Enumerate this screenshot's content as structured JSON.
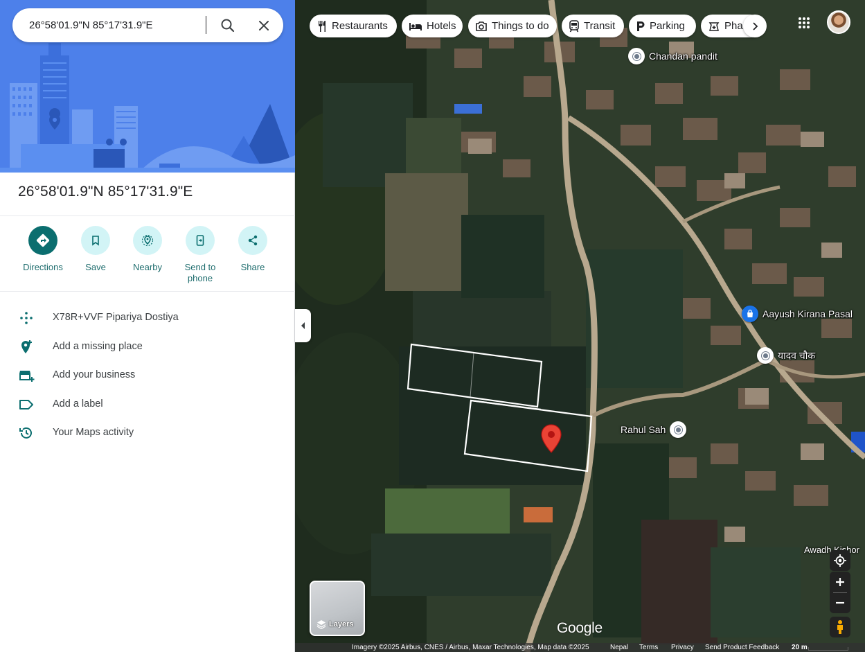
{
  "search": {
    "value": "26°58'01.9\"N 85°17'31.9\"E",
    "placeholder": ""
  },
  "place": {
    "title": "26°58'01.9\"N 85°17'31.9\"E"
  },
  "actions": [
    {
      "label": "Directions",
      "icon": "directions-icon"
    },
    {
      "label": "Save",
      "icon": "bookmark-icon"
    },
    {
      "label": "Nearby",
      "icon": "nearby-icon"
    },
    {
      "label": "Send to phone",
      "icon": "send-to-phone-icon"
    },
    {
      "label": "Share",
      "icon": "share-icon"
    }
  ],
  "info_items": [
    {
      "label": "X78R+VVF Pipariya Dostiya",
      "icon": "plus-code-icon"
    },
    {
      "label": "Add a missing place",
      "icon": "add-place-icon"
    },
    {
      "label": "Add your business",
      "icon": "add-business-icon"
    },
    {
      "label": "Add a label",
      "icon": "label-icon"
    },
    {
      "label": "Your Maps activity",
      "icon": "history-icon"
    }
  ],
  "chips": [
    {
      "label": "Restaurants",
      "icon": "restaurant-icon"
    },
    {
      "label": "Hotels",
      "icon": "hotel-icon"
    },
    {
      "label": "Things to do",
      "icon": "camera-icon"
    },
    {
      "label": "Transit",
      "icon": "transit-icon"
    },
    {
      "label": "Parking",
      "icon": "parking-icon"
    },
    {
      "label": "Phar",
      "icon": "pharmacy-icon"
    }
  ],
  "pois": [
    {
      "name": "Chandan pandit"
    },
    {
      "name": "Aayush Kirana Pasal"
    },
    {
      "name": "यादव चौक"
    },
    {
      "name": "Rahul Sah"
    }
  ],
  "street_label": "Awadh Kishor",
  "layers_label": "Layers",
  "logo_text": "Google",
  "footer": {
    "imagery": "Imagery ©2025 Airbus, CNES / Airbus, Maxar Technologies, Map data ©2025",
    "region": "Nepal",
    "terms": "Terms",
    "privacy": "Privacy",
    "feedback": "Send Product Feedback",
    "scale": "20 m"
  },
  "colors": {
    "accent": "#0b6e6f",
    "action_bg": "#d2f4f6",
    "hero_blue": "#4a7ee8",
    "pin_red": "#ea4335"
  }
}
